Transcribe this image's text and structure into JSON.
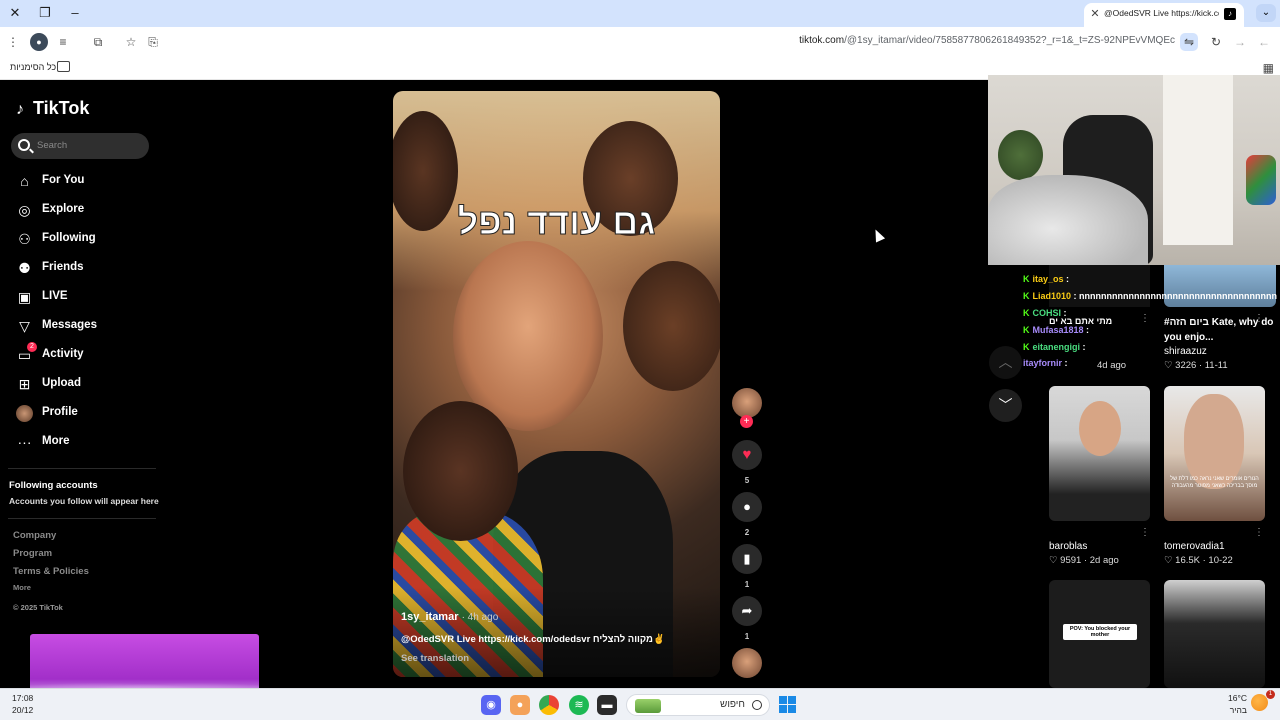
{
  "browser": {
    "tab_title": "@OdedSVR Live https://kick.com",
    "tab_favicon": "tiktok-icon",
    "url_host": "tiktok.com",
    "url_path": "/@1sy_itamar/video/7585877806261849352?_r=1&_t=ZS-92NPEvVMQEc",
    "bookmarks_label": "כל הסימניות"
  },
  "tiktok": {
    "logo": "TikTok",
    "search_placeholder": "Search",
    "nav": [
      {
        "label": "For You",
        "icon": "home-icon"
      },
      {
        "label": "Explore",
        "icon": "compass-icon"
      },
      {
        "label": "Following",
        "icon": "following-icon"
      },
      {
        "label": "Friends",
        "icon": "friends-icon"
      },
      {
        "label": "LIVE",
        "icon": "live-icon"
      },
      {
        "label": "Messages",
        "icon": "messages-icon"
      },
      {
        "label": "Activity",
        "icon": "activity-icon",
        "badge": "2"
      },
      {
        "label": "Upload",
        "icon": "upload-icon"
      },
      {
        "label": "Profile",
        "icon": "avatar-icon"
      },
      {
        "label": "More",
        "icon": "more-icon"
      }
    ],
    "following_accounts_title": "Following accounts",
    "following_accounts_sub": "Accounts you follow will appear here",
    "footer": [
      "Company",
      "Program",
      "Terms & Policies",
      "More"
    ],
    "copyright": "© 2025 TikTok"
  },
  "video": {
    "overlay_text": "גם עודד נפל",
    "author": "1sy_itamar",
    "age": "· 4h ago",
    "caption": "@OdedSVR Live  https://kick.com/odedsvr מקווה להצליח✌️",
    "see_translation": "See translation",
    "likes": "5",
    "comments": "2",
    "saves": "1",
    "shares": "1"
  },
  "chat": [
    {
      "user": "itay_os",
      "msg": ":"
    },
    {
      "user": "Liad1010",
      "msg": ": nnnnnnnnnnnnnnnnnnnnnnnnnnnnnnnnnnnn"
    },
    {
      "user": "COHSI",
      "msg": ":"
    },
    {
      "user": "Mufasa1818",
      "msg": ":"
    },
    {
      "user": "eitanengigi",
      "msg": ":"
    },
    {
      "user": "itayfornir",
      "msg": ":"
    }
  ],
  "recommendations": {
    "top_right_title": "#ביום הזה Kate, why do you enjo...",
    "top_right_user": "shiraazuz",
    "top_right_meta": "♡ 3226 · 11-11",
    "top_left_title": "מתי אתם בא ים",
    "top_left_meta": "4d ago",
    "cards": [
      {
        "user": "baroblas",
        "meta": "♡ 9591 · 2d ago"
      },
      {
        "user": "tomerovadia1",
        "meta": "♡ 16.5K · 10-22",
        "thumb_text": "הנורים אומרים שאני נראה כמו דלת של מוסך בבריכה כשאני מפוטר מהעבודה"
      },
      {
        "pov": "POV: You blocked your mother"
      },
      {}
    ]
  },
  "taskbar": {
    "time": "17:08",
    "date": "20/12",
    "search_label": "חיפוש",
    "temperature": "16°C",
    "weather_desc": "בהיר",
    "notif_count": "1"
  }
}
